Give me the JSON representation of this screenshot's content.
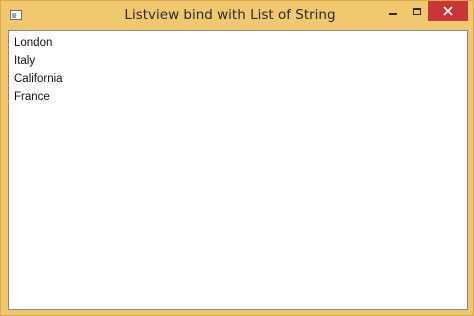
{
  "window": {
    "title": "Listview bind with List of String"
  },
  "controls": {
    "minimize": "minimize-icon",
    "maximize": "maximize-icon",
    "close": "close-icon"
  },
  "listview": {
    "items": [
      {
        "label": "London"
      },
      {
        "label": "Italy"
      },
      {
        "label": "California"
      },
      {
        "label": "France"
      }
    ]
  },
  "colors": {
    "frame": "#f1c870",
    "close_button": "#c73737",
    "list_background": "#ffffff"
  }
}
